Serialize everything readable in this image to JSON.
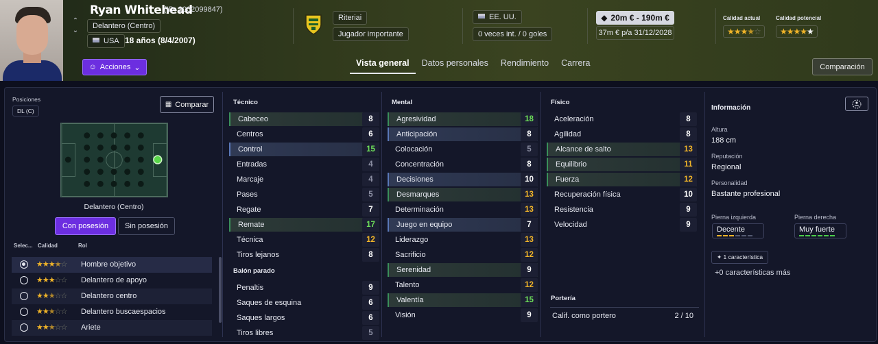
{
  "player": {
    "name": "Ryan Whitehead",
    "id": "(ID: 2002099847)",
    "position": "Delantero (Centro)",
    "nationality": "USA",
    "age": "18 años (8/4/2007)"
  },
  "header": {
    "actions_label": "Acciones",
    "club": "Riteriai",
    "status": "Jugador importante",
    "nation": "EE. UU.",
    "caps": "0 veces int. / 0 goles",
    "value": "20m € - 190m €",
    "wage": "37m € p/a",
    "contract": "31/12/2028",
    "current_ability_label": "Calidad actual",
    "potential_ability_label": "Calidad potencial",
    "current_ability_stars": 3.5,
    "potential_ability_stars": 4.5,
    "compare_button": "Comparación"
  },
  "tabs": [
    "Vista general",
    "Datos personales",
    "Rendimiento",
    "Carrera"
  ],
  "active_tab": "Vista general",
  "positions": {
    "label": "Posiciones",
    "chip": "DL (C)",
    "compare_label": "Comparar",
    "selected_position": "Delantero (Centro)",
    "toggle_on": "Con posesión",
    "toggle_off": "Sin posesión"
  },
  "roles": {
    "headers": [
      "Selec...",
      "Calidad",
      "Rol"
    ],
    "items": [
      {
        "name": "Hombre objetivo",
        "stars": 3.5,
        "selected": true
      },
      {
        "name": "Delantero de apoyo",
        "stars": 3,
        "selected": false
      },
      {
        "name": "Delantero centro",
        "stars": 2.5,
        "selected": false
      },
      {
        "name": "Delantero buscaespacios",
        "stars": 2.5,
        "selected": false
      },
      {
        "name": "Ariete",
        "stars": 2.5,
        "selected": false
      }
    ]
  },
  "technical": {
    "title": "Técnico",
    "items": [
      {
        "name": "Cabeceo",
        "value": "8",
        "hl": "g"
      },
      {
        "name": "Centros",
        "value": "6",
        "hl": ""
      },
      {
        "name": "Control",
        "value": "15",
        "hl": "b"
      },
      {
        "name": "Entradas",
        "value": "4",
        "hl": ""
      },
      {
        "name": "Marcaje",
        "value": "4",
        "hl": ""
      },
      {
        "name": "Pases",
        "value": "5",
        "hl": ""
      },
      {
        "name": "Regate",
        "value": "7",
        "hl": ""
      },
      {
        "name": "Remate",
        "value": "17",
        "hl": "g"
      },
      {
        "name": "Técnica",
        "value": "12",
        "hl": ""
      },
      {
        "name": "Tiros lejanos",
        "value": "8",
        "hl": ""
      }
    ]
  },
  "set_pieces": {
    "title": "Balón parado",
    "items": [
      {
        "name": "Penaltis",
        "value": "9",
        "hl": ""
      },
      {
        "name": "Saques de esquina",
        "value": "6",
        "hl": ""
      },
      {
        "name": "Saques largos",
        "value": "6",
        "hl": ""
      },
      {
        "name": "Tiros libres",
        "value": "5",
        "hl": ""
      }
    ]
  },
  "mental": {
    "title": "Mental",
    "items": [
      {
        "name": "Agresividad",
        "value": "18",
        "hl": "g"
      },
      {
        "name": "Anticipación",
        "value": "8",
        "hl": "b"
      },
      {
        "name": "Colocación",
        "value": "5",
        "hl": ""
      },
      {
        "name": "Concentración",
        "value": "8",
        "hl": ""
      },
      {
        "name": "Decisiones",
        "value": "10",
        "hl": "b"
      },
      {
        "name": "Desmarques",
        "value": "13",
        "hl": "g"
      },
      {
        "name": "Determinación",
        "value": "13",
        "hl": ""
      },
      {
        "name": "Juego en equipo",
        "value": "7",
        "hl": "b"
      },
      {
        "name": "Liderazgo",
        "value": "13",
        "hl": ""
      },
      {
        "name": "Sacrificio",
        "value": "12",
        "hl": ""
      },
      {
        "name": "Serenidad",
        "value": "9",
        "hl": "g"
      },
      {
        "name": "Talento",
        "value": "12",
        "hl": ""
      },
      {
        "name": "Valentía",
        "value": "15",
        "hl": "g"
      },
      {
        "name": "Visión",
        "value": "9",
        "hl": ""
      }
    ]
  },
  "physical": {
    "title": "Físico",
    "items": [
      {
        "name": "Aceleración",
        "value": "8",
        "hl": ""
      },
      {
        "name": "Agilidad",
        "value": "8",
        "hl": ""
      },
      {
        "name": "Alcance de salto",
        "value": "13",
        "hl": "g"
      },
      {
        "name": "Equilibrio",
        "value": "11",
        "hl": "g"
      },
      {
        "name": "Fuerza",
        "value": "12",
        "hl": "g"
      },
      {
        "name": "Recuperación física",
        "value": "10",
        "hl": ""
      },
      {
        "name": "Resistencia",
        "value": "9",
        "hl": ""
      },
      {
        "name": "Velocidad",
        "value": "9",
        "hl": ""
      }
    ]
  },
  "goalkeeping": {
    "title": "Portería",
    "label": "Calif. como portero",
    "value": "2 / 10"
  },
  "info": {
    "title": "Información",
    "height_label": "Altura",
    "height": "188 cm",
    "reputation_label": "Reputación",
    "reputation": "Regional",
    "personality_label": "Personalidad",
    "personality": "Bastante profesional",
    "left_foot_label": "Pierna izquierda",
    "left_foot": "Decente",
    "left_foot_level": 3,
    "right_foot_label": "Pierna derecha",
    "right_foot": "Muy fuerte",
    "right_foot_level": 6,
    "traits_chip": "1 característica",
    "traits_more": "+0 características más"
  },
  "colors": {
    "accent": "#6c2ee0",
    "star": "#f0b429",
    "good": "#6ee05a",
    "average": "#f0b429",
    "poor": "#8c8fa3",
    "foot_left": "#f0b429",
    "foot_right": "#4ccd4c"
  }
}
